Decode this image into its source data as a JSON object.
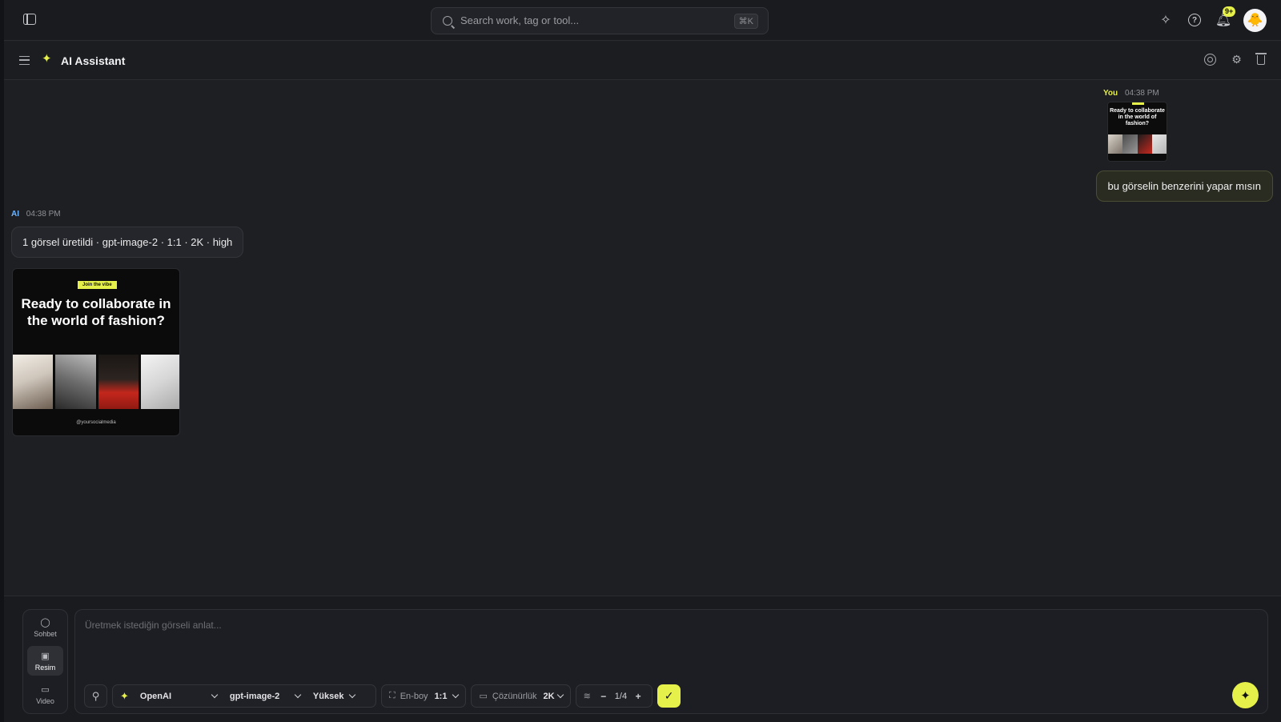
{
  "topbar": {
    "search_placeholder": "Search work, tag or tool...",
    "search_shortcut": "⌘K",
    "notifications_badge": "9+"
  },
  "header": {
    "title": "AI Assistant"
  },
  "chat": {
    "user_message": {
      "sender": "You",
      "time": "04:38 PM",
      "text": "bu görselin benzerini yapar mısın",
      "thumb_title": "Ready to collaborate in the world of fashion?"
    },
    "ai_message": {
      "sender": "AI",
      "time": "04:38 PM",
      "text": "1 görsel üretildi · gpt-image-2 · 1:1 · 2K · high",
      "image": {
        "tag": "Join the vibe",
        "title": "Ready to collaborate in the world of fashion?",
        "handle": "@yoursocialmedia"
      }
    }
  },
  "composer": {
    "modes": [
      {
        "label": "Sohbet",
        "icon": "chat-bubble-icon"
      },
      {
        "label": "Resim",
        "icon": "image-icon",
        "active": true
      },
      {
        "label": "Video",
        "icon": "video-icon"
      }
    ],
    "placeholder": "Üretmek istediğin görseli anlat...",
    "provider": "OpenAI",
    "model": "gpt-image-2",
    "quality": "Yüksek",
    "aspect_label": "En-boy",
    "aspect_value": "1:1",
    "resolution_label": "Çözünürlük",
    "resolution_value": "2K",
    "count_value": "1/4"
  },
  "colors": {
    "accent": "#e6f04a",
    "background": "#1e1f23",
    "ai_label": "#6fb6ff"
  }
}
